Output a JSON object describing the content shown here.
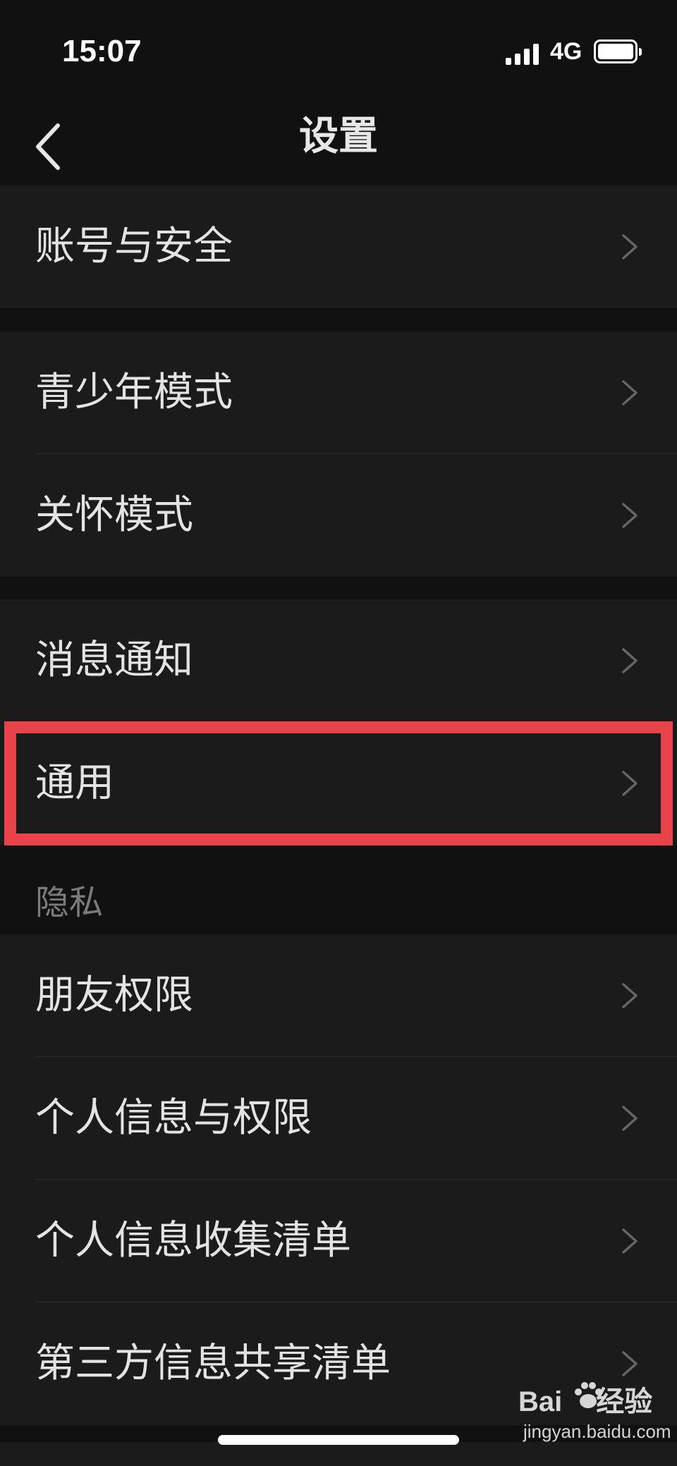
{
  "status_bar": {
    "time": "15:07",
    "network": "4G",
    "icons": [
      "signal-icon",
      "battery-icon"
    ]
  },
  "nav": {
    "title": "设置",
    "back_icon": "back-chevron-icon"
  },
  "groups": [
    {
      "items": [
        {
          "label": "账号与安全"
        }
      ]
    },
    {
      "items": [
        {
          "label": "青少年模式"
        },
        {
          "label": "关怀模式"
        }
      ]
    },
    {
      "items": [
        {
          "label": "消息通知"
        },
        {
          "label": "通用",
          "highlighted": true
        }
      ]
    },
    {
      "header": "隐私",
      "items": [
        {
          "label": "朋友权限"
        },
        {
          "label": "个人信息与权限"
        },
        {
          "label": "个人信息收集清单"
        },
        {
          "label": "第三方信息共享清单"
        }
      ]
    }
  ],
  "colors": {
    "background": "#111111",
    "cell": "#1b1b1b",
    "highlight": "#e8434b",
    "chevron": "#666666"
  },
  "watermark": {
    "brand_prefix": "Bai",
    "brand_suffix": "经验",
    "url": "jingyan.baidu.com"
  }
}
